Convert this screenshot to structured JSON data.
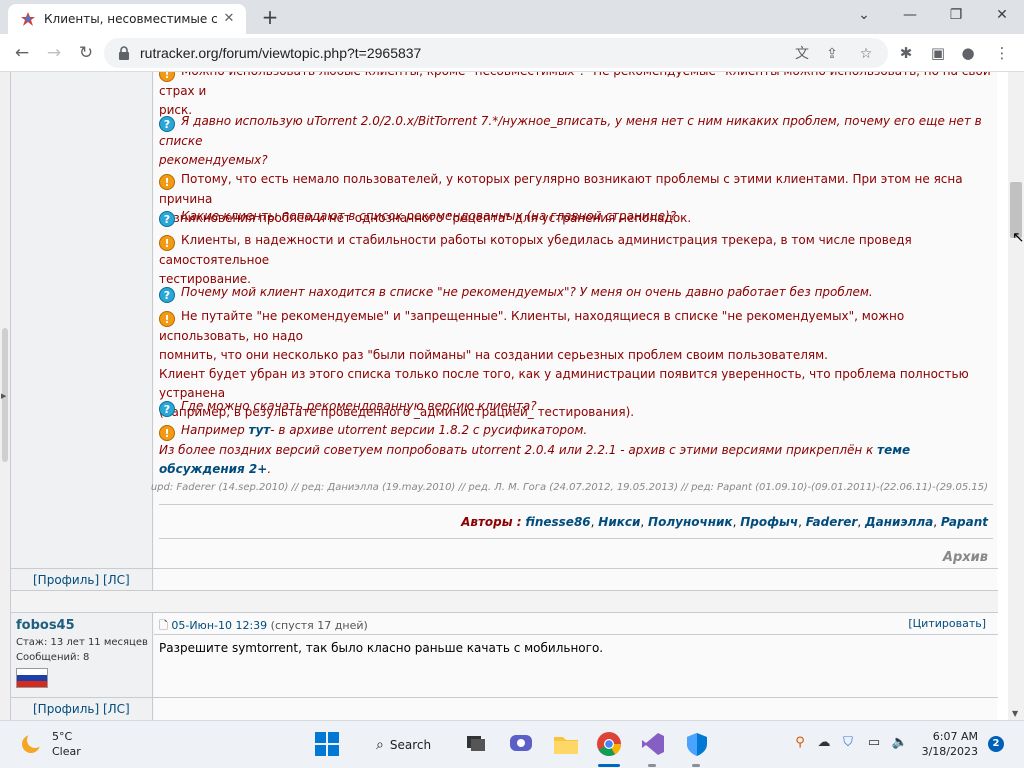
{
  "browser": {
    "tab_title": "Клиенты, несовместимые с тре...",
    "tab_close": "✕",
    "newtab": "+",
    "url": "rutracker.org/forum/viewtopic.php?t=2965837"
  },
  "faq": {
    "prev_line_1": "Можно использовать любые клиенты, кроме \"несовместимых\". \"Не рекомендуемые\" клиенты можно использовать, но на свой страх и",
    "prev_line_2": "риск.",
    "q1": "Я давно использую uTorrent 2.0/2.0.x/BitTorrent 7.*/нужное_вписать, у меня нет с ним никаких проблем, почему его еще нет в списке",
    "q1b": "рекомендуемых?",
    "a1": "Потому, что есть немало пользователей, у которых регулярно возникают проблемы с этими клиентами. При этом не ясна причина",
    "a1b": "возникновения проблем и нет однозначного \"рецепта\" для устранения неполадок.",
    "q2": "Какие клиенты попадают в список рекомендованных (на главной странице)?",
    "a2": "Клиенты, в надежности и стабильности работы которых убедилась администрация трекера, в том числе проведя самостоятельное",
    "a2b": "тестирование.",
    "q3": "Почему мой клиент находится в списке \"не рекомендуемых\"? У меня он очень давно работает без проблем.",
    "a3": "Не путайте \"не рекомендуемые\" и \"запрещенные\". Клиенты, находящиеся в списке \"не рекомендуемых\", можно использовать, но надо",
    "a3b": "помнить, что они несколько раз \"были пойманы\" на создании серьезных проблем своим пользователям.",
    "a3c": "Клиент будет убран из этого списка только после того, как у администрации появится уверенность, что проблема полностью устранена",
    "a3d": "(например, в результате проведенного _администрацией_ тестирования).",
    "q4": "Где можно скачать рекомендованную версию клиента?",
    "a4_pre": "Например",
    "a4_link": "тут",
    "a4_post": "- в архиве utorrent версии 1.8.2 с русификатором.",
    "a4b_pre": "Из более поздних версий советуем попробовать utorrent 2.0.4 или 2.2.1 - архив с этими версиями прикреплён к",
    "a4b_link": "теме обсуждения 2+",
    "a4b_post": "."
  },
  "upd": "upd: Faderer (14.sep.2010) // ред: Даниэлла (19.may.2010) // ред. Л. М. Гога (24.07.2012, 19.05.2013) // ред: Papant (01.09.10)-(09.01.2011)-(22.06.11)-(29.05.15)",
  "authors": {
    "label": "Авторы :",
    "names": [
      "finesse86",
      "Никси",
      "Полуночник",
      "Профыч",
      "Faderer",
      "Даниэлла",
      "Papant"
    ]
  },
  "archive": "Архив",
  "profile_links": "[Профиль]  [ЛС]",
  "post2": {
    "username": "fobos45",
    "stazh": "Стаж: 13 лет 11 месяцев",
    "messages": "Сообщений: 8",
    "date": "05-Июн-10 12:39",
    "after": "(спустя 17 дней)",
    "cite": "[Цитировать]",
    "text": "Разрешите symtorrent, так было класно раньше качать с мобильного."
  },
  "taskbar": {
    "temp": "5°C",
    "cond": "Clear",
    "search": "Search",
    "time": "6:07 AM",
    "date": "3/18/2023",
    "notif": "2"
  },
  "colors": {
    "question": "#8b0000",
    "link": "#004c7d",
    "accent": "#2aa7d6"
  }
}
